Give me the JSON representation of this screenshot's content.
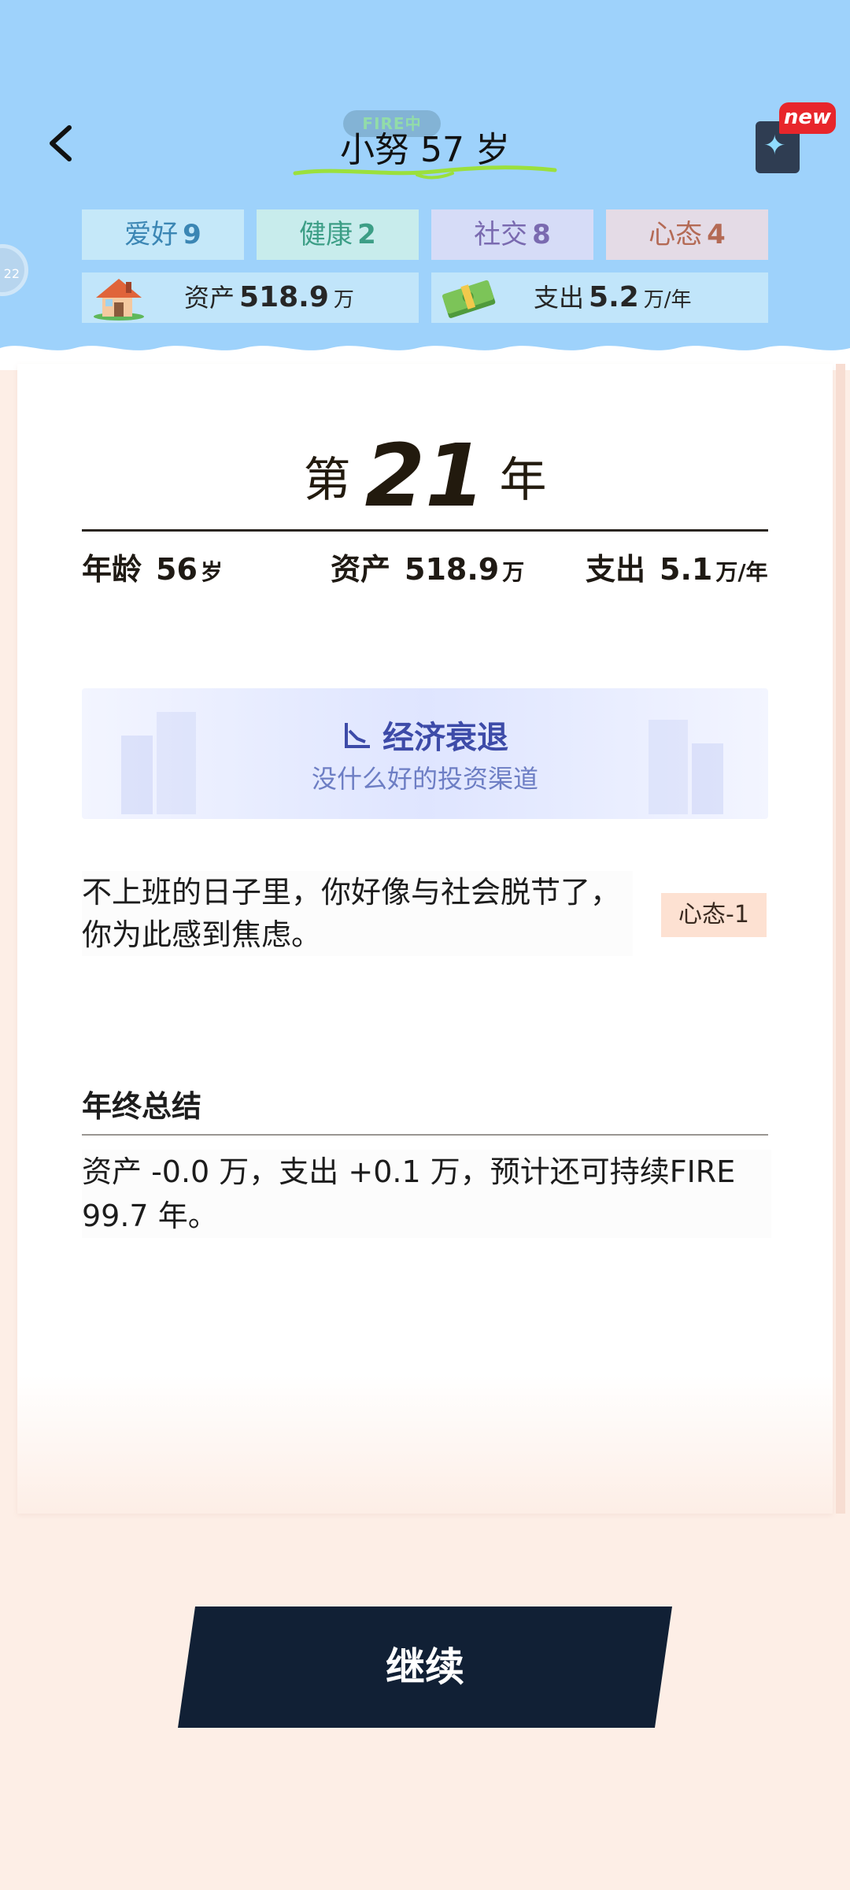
{
  "header": {
    "title": "小努 57 岁",
    "title_tag": "FIRE中",
    "new_badge": "new",
    "avatar_edge_text": "22",
    "stats": {
      "hobby": {
        "label": "爱好",
        "value": "9"
      },
      "health": {
        "label": "健康",
        "value": "2"
      },
      "social": {
        "label": "社交",
        "value": "8"
      },
      "mood": {
        "label": "心态",
        "value": "4"
      }
    },
    "assets": {
      "label": "资产",
      "value": "518.9",
      "unit": "万",
      "icon": "house-icon"
    },
    "expense": {
      "label": "支出",
      "value": "5.2",
      "unit": "万/年",
      "icon": "money-stack-icon"
    }
  },
  "year": {
    "prefix": "第",
    "number": "21",
    "suffix": "年"
  },
  "info": {
    "age": {
      "label": "年龄",
      "value": "56",
      "unit": "岁"
    },
    "assets": {
      "label": "资产",
      "value": "518.9",
      "unit": "万"
    },
    "expense": {
      "label": "支出",
      "value": "5.1",
      "unit": "万/年"
    }
  },
  "event": {
    "title": "经济衰退",
    "subtitle": "没什么好的投资渠道",
    "icon": "chart-decline-icon"
  },
  "event_text": "不上班的日子里，你好像与社会脱节了，你为此感到焦虑。",
  "event_effect": "心态-1",
  "summary": {
    "title": "年终总结",
    "text": "资产 -0.0 万，支出 +0.1 万，预计还可持续FIRE 99.7 年。"
  },
  "continue_label": "继续",
  "colors": {
    "header_bg": "#9ed2fb",
    "page_bg": "#fdeee6",
    "button_bg": "#112035",
    "event_accent": "#3d4ba8",
    "badge_red": "#e8262b"
  }
}
